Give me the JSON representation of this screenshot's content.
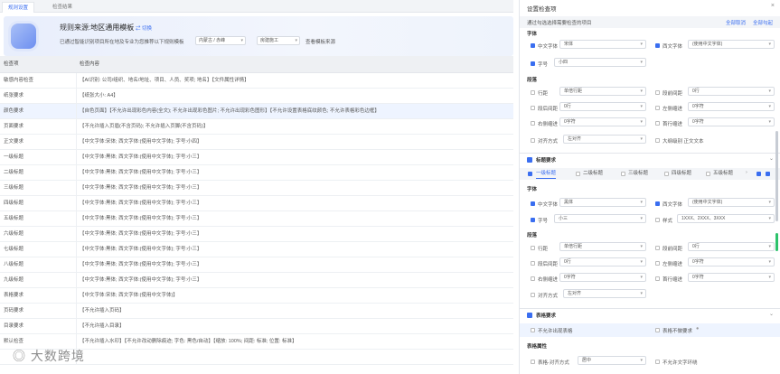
{
  "tabs": [
    "规则设置",
    "检查结果"
  ],
  "banner": {
    "title_prefix": "规则来源:",
    "title": "地区通用模板",
    "switch": "切换",
    "desc": "已通过智能识别项目所在地及专业为您推荐以下规则模板",
    "sel1": "内蒙古 / 赤峰",
    "sel2": "房建施工",
    "view_source": "查看模板来源"
  },
  "table": {
    "headers": [
      "检查项",
      "检查内容"
    ],
    "rows": [
      {
        "item": "敏感内容检查",
        "content": "【AI识别: 公司/组织、地名/地址、项目、人员、奖项; 地名】【文件属性详情】"
      },
      {
        "item": "纸张要求",
        "content": "【纸张大小: A4】"
      },
      {
        "item": "颜色要求",
        "content": "【自色页面】【不允许出现彩色内容(全文); 不允许出现彩色图片; 不允许出现彩色图形】【不允许设置表格底纹颜色; 不允许表格彩色边框】"
      },
      {
        "item": "页面要求",
        "content": "【不允许插入页眉(不含页码); 不允许插入页脚(不含页码)】"
      },
      {
        "item": "正文要求",
        "content": "【中文字体:宋体; 西文字体:(使用中文字体); 字号:小四】"
      },
      {
        "item": "一级标题",
        "content": "【中文字体:黑体; 西文字体:(使用中文字体); 字号:小三】"
      },
      {
        "item": "二级标题",
        "content": "【中文字体:黑体; 西文字体:(使用中文字体); 字号:小三】"
      },
      {
        "item": "三级标题",
        "content": "【中文字体:黑体; 西文字体:(使用中文字体); 字号:小三】"
      },
      {
        "item": "四级标题",
        "content": "【中文字体:黑体; 西文字体:(使用中文字体); 字号:小三】"
      },
      {
        "item": "五级标题",
        "content": "【中文字体:黑体; 西文字体:(使用中文字体); 字号:小三】"
      },
      {
        "item": "六级标题",
        "content": "【中文字体:黑体; 西文字体:(使用中文字体); 字号:小三】"
      },
      {
        "item": "七级标题",
        "content": "【中文字体:黑体; 西文字体:(使用中文字体); 字号:小三】"
      },
      {
        "item": "八级标题",
        "content": "【中文字体:黑体; 西文字体:(使用中文字体); 字号:小三】"
      },
      {
        "item": "九级标题",
        "content": "【中文字体:黑体; 西文字体:(使用中文字体); 字号:小三】"
      },
      {
        "item": "表格要求",
        "content": "【中文字体:宋体; 西文字体:(使用中文字体)】"
      },
      {
        "item": "页码要求",
        "content": "【不允许插入页码】"
      },
      {
        "item": "目录要求",
        "content": "【不允许插入目录】"
      },
      {
        "item": "默认检查",
        "content": "【不允许插入水印】【不允许改动删除痕迹; 字色: 黑色/自动】【缩放: 100%; 间距: 标准; 位置: 标准】"
      },
      {
        "item": "",
        "content": ""
      }
    ],
    "highlight": 2
  },
  "panel": {
    "title": "设置检查项",
    "close": "×",
    "subtitle": "通过勾选选择需要检查的项目",
    "cancel_all": "全部取消",
    "select_all": "全部勾起",
    "font_label": "字体",
    "para_label": "段落",
    "body": {
      "cn_font_label": "中文字体",
      "cn_font": "宋体",
      "en_font_label": "西文字体",
      "en_font": "(使用中文字体)",
      "size_label": "字号",
      "size": "小四",
      "p": [
        [
          "行距",
          "单倍行距",
          "段前间距",
          "0行"
        ],
        [
          "段后间距",
          "0行",
          "左侧缩进",
          "0字符"
        ],
        [
          "右侧缩进",
          "0字符",
          "首行缩进",
          "0字符"
        ]
      ],
      "align_label": "对齐方式",
      "align": "左对齐",
      "outline_label": "大纲级别",
      "outline": "正文文本"
    },
    "heading": {
      "title": "标题要求",
      "tabs": [
        "一级标题",
        "二级标题",
        "三级标题",
        "四级标题",
        "五级标题"
      ],
      "cn_font": "黑体",
      "en_font": "(使用中文字体)",
      "size": "小三",
      "style_label": "样式",
      "style": "1XXX、2XXX、3XXX",
      "p": [
        [
          "行距",
          "单倍行距",
          "段前间距",
          "0行"
        ],
        [
          "段后间距",
          "0行",
          "左侧缩进",
          "0字符"
        ],
        [
          "右侧缩进",
          "0字符",
          "首行缩进",
          "0字符"
        ]
      ],
      "align": "左对齐"
    },
    "table": {
      "title": "表格要求",
      "no_table": "不允许出现表格",
      "no_req": "表格不做要求",
      "attr_label": "表格属性",
      "t_align_label": "表格-对齐方式",
      "t_align": "居中",
      "no_wrap": "不允许文字环绕"
    }
  },
  "watermark": "大数跨境"
}
